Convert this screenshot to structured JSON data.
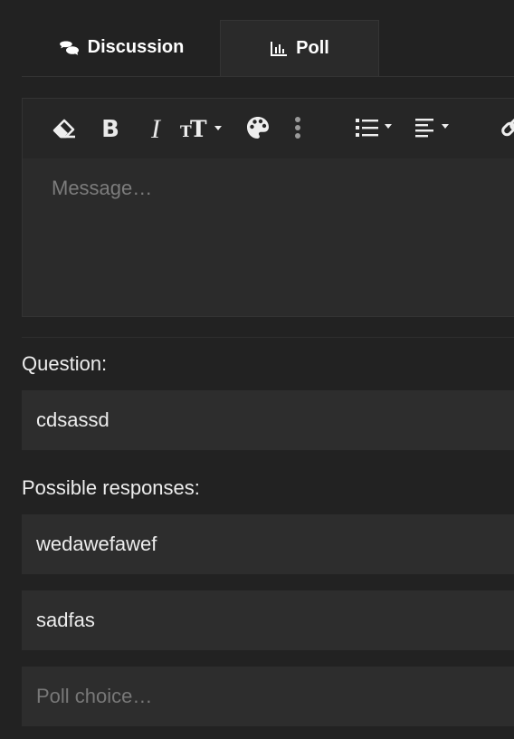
{
  "tabs": [
    {
      "label": "Discussion",
      "icon": "comments-icon",
      "active": false
    },
    {
      "label": "Poll",
      "icon": "bar-chart-icon",
      "active": true
    }
  ],
  "toolbar": {
    "buttons": [
      "eraser-icon",
      "bold-icon",
      "italic-icon",
      "text-size-icon",
      "palette-icon",
      "more-vertical-icon",
      "list-icon",
      "align-left-icon",
      "link-icon"
    ]
  },
  "editor": {
    "placeholder": "Message…",
    "value": ""
  },
  "question": {
    "label": "Question:",
    "value": "cdsassd"
  },
  "responses": {
    "label": "Possible responses:",
    "choices": [
      "wedawefawef",
      "sadfas"
    ],
    "new_placeholder": "Poll choice…"
  },
  "colors": {
    "background": "#222222",
    "field": "#2d2d2d",
    "text": "#ededed",
    "placeholder": "#787878"
  }
}
